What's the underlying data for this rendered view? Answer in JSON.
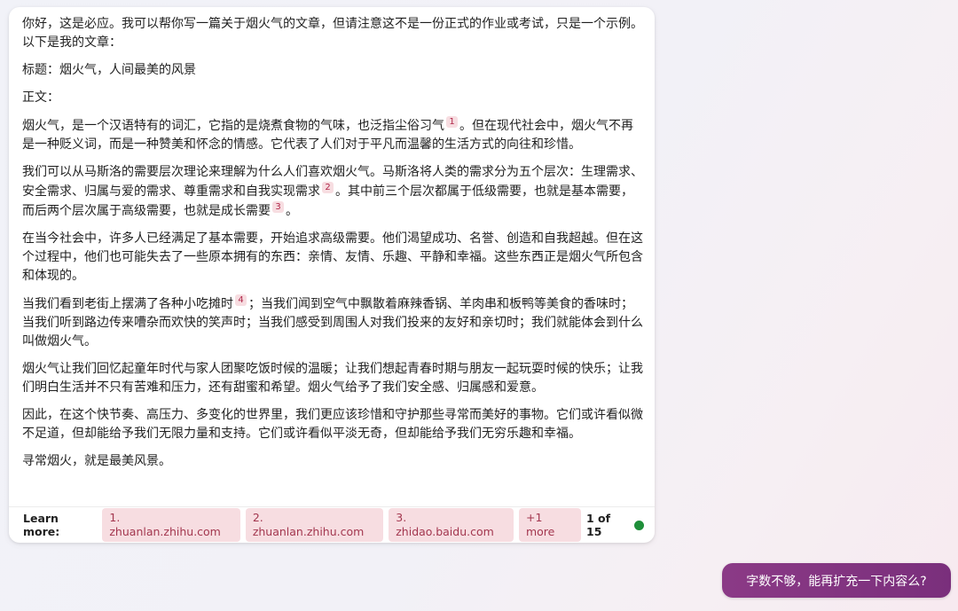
{
  "response": {
    "intro": "你好，这是必应。我可以帮你写一篇关于烟火气的文章，但请注意这不是一份正式的作业或考试，只是一个示例。以下是我的文章：",
    "title_line": "标题：烟火气，人间最美的风景",
    "body_label": "正文：",
    "p1_a": "烟火气，是一个汉语特有的词汇，它指的是烧煮食物的气味，也泛指尘俗习气",
    "p1_cite": "1",
    "p1_b": "。但在现代社会中，烟火气不再是一种贬义词，而是一种赞美和怀念的情感。它代表了人们对于平凡而温馨的生活方式的向往和珍惜。",
    "p2_a": "我们可以从马斯洛的需要层次理论来理解为什么人们喜欢烟火气。马斯洛将人类的需求分为五个层次：生理需求、安全需求、归属与爱的需求、尊重需求和自我实现需求",
    "p2_cite1": "2",
    "p2_b": "。其中前三个层次都属于低级需要，也就是基本需要，而后两个层次属于高级需要，也就是成长需要",
    "p2_cite2": "3",
    "p2_c": "。",
    "p3": "在当今社会中，许多人已经满足了基本需要，开始追求高级需要。他们渴望成功、名誉、创造和自我超越。但在这个过程中，他们也可能失去了一些原本拥有的东西：亲情、友情、乐趣、平静和幸福。这些东西正是烟火气所包含和体现的。",
    "p4_a": "当我们看到老街上摆满了各种小吃摊时",
    "p4_cite": "4",
    "p4_b": "；当我们闻到空气中飘散着麻辣香锅、羊肉串和板鸭等美食的香味时；当我们听到路边传来嘈杂而欢快的笑声时；当我们感受到周围人对我们投来的友好和亲切时；我们就能体会到什么叫做烟火气。",
    "p5": "烟火气让我们回忆起童年时代与家人团聚吃饭时候的温暖；让我们想起青春时期与朋友一起玩耍时候的快乐；让我们明白生活并不只有苦难和压力，还有甜蜜和希望。烟火气给予了我们安全感、归属感和爱意。",
    "p6": "因此，在这个快节奏、高压力、多变化的世界里，我们更应该珍惜和守护那些寻常而美好的事物。它们或许看似微不足道，但却能给予我们无限力量和支持。它们或许看似平淡无奇，但却能给予我们无穷乐趣和幸福。",
    "p7": "寻常烟火，就是最美风景。"
  },
  "footer": {
    "learn_more_label": "Learn more:",
    "links": [
      "1. zhuanlan.zhihu.com",
      "2. zhuanlan.zhihu.com",
      "3. zhidao.baidu.com",
      "+1 more"
    ],
    "page_count": "1 of 15",
    "status_color": "#1f8f3a"
  },
  "user_message": "字数不够，能再扩充一下内容么?",
  "colors": {
    "citation_bg": "#f7dde1",
    "citation_text": "#b0284a",
    "user_bubble": "#8b3a86"
  }
}
